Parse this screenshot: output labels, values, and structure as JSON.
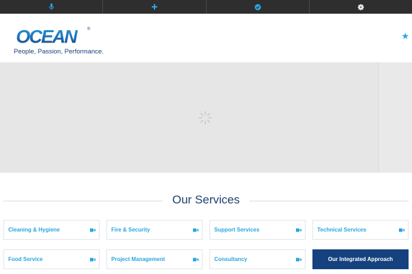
{
  "topbar": {
    "items": [
      {
        "icon": "microphone-icon"
      },
      {
        "icon": "plus-icon"
      },
      {
        "icon": "check-circle-icon"
      },
      {
        "icon": "gear-icon"
      }
    ],
    "accent": "#2aa6e0",
    "background": "#2e2e2e"
  },
  "header": {
    "logo_text": "OCEAN",
    "logo_mark": "®",
    "tagline": "People, Passion, Performance.",
    "star_icon": "star-icon"
  },
  "hero": {
    "loader_icon": "loading-spinner-icon"
  },
  "services": {
    "title": "Our Services",
    "items": [
      {
        "label": "Cleaning & Hygiene",
        "icon": "video-icon"
      },
      {
        "label": "Fire & Security",
        "icon": "video-icon"
      },
      {
        "label": "Support Services",
        "icon": "video-icon"
      },
      {
        "label": "Technical Services",
        "icon": "video-icon"
      },
      {
        "label": "Food Service",
        "icon": "video-icon"
      },
      {
        "label": "Project Management",
        "icon": "video-icon"
      },
      {
        "label": "Consultancy",
        "icon": "video-icon"
      },
      {
        "label": "Our Integrated Approach"
      }
    ]
  },
  "colors": {
    "brand_navy": "#15427f",
    "brand_blue": "#2aa6e0"
  }
}
